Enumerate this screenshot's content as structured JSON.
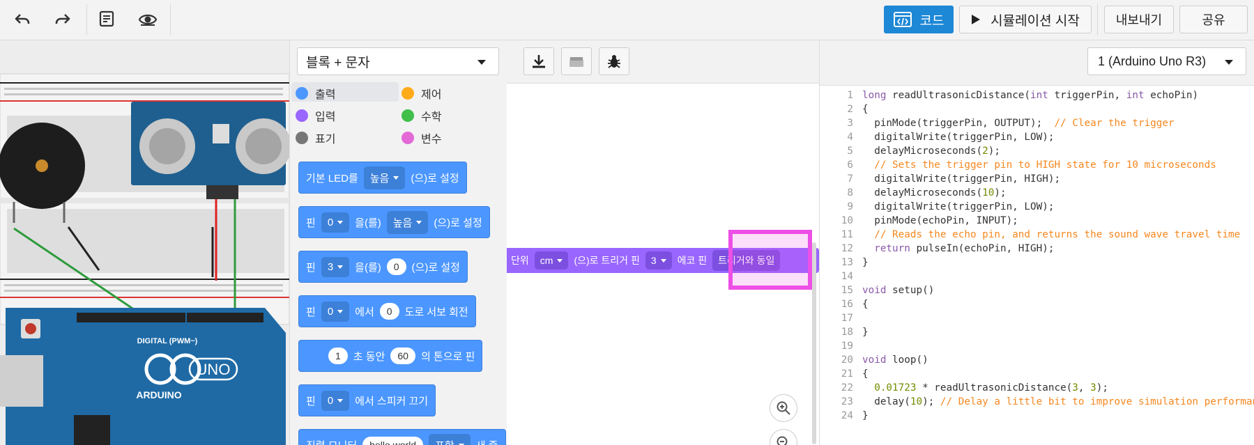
{
  "toolbar": {
    "undo_icon": "undo-icon",
    "redo_icon": "redo-icon",
    "notes_icon": "notes-icon",
    "eye_icon": "visibility-icon",
    "code_label": "코드",
    "simulate_label": "시뮬레이션 시작",
    "export_label": "내보내기",
    "share_label": "공유"
  },
  "palette": {
    "mode_select": "블록 + 문자",
    "categories": [
      {
        "label": "출력",
        "color": "#4c97ff"
      },
      {
        "label": "제어",
        "color": "#ffab19"
      },
      {
        "label": "입력",
        "color": "#9966ff"
      },
      {
        "label": "수학",
        "color": "#40bf4a"
      },
      {
        "label": "표기",
        "color": "#777777"
      },
      {
        "label": "변수",
        "color": "#e36ad6"
      }
    ],
    "blocks": {
      "b1": {
        "text1": "기본 LED를",
        "drop": "높음",
        "text2": "(으)로 설정"
      },
      "b2": {
        "text1": "핀",
        "drop1": "0",
        "text2": "을(를)",
        "drop2": "높음",
        "text3": "(으)로 설정"
      },
      "b3": {
        "text1": "핀",
        "drop1": "3",
        "text2": "을(를)",
        "val": "0",
        "text3": "(으)로 설정"
      },
      "b4": {
        "text1": "핀",
        "drop1": "0",
        "text2": "에서",
        "val": "0",
        "text3": "도로 서보 회전"
      },
      "b5": {
        "val1": "1",
        "text1": "초 동안",
        "val2": "60",
        "text2": "의 톤으로 핀"
      },
      "b6": {
        "text1": "핀",
        "drop1": "0",
        "text2": "에서 스피커 끄기"
      },
      "b7": {
        "text1": "직렬 모니터",
        "val": "hello world",
        "drop": "포함",
        "text2": "새 줄"
      }
    }
  },
  "canvas": {
    "download_icon": "download-icon",
    "library_icon": "library-icon",
    "debug_icon": "bug-icon",
    "purple_block": {
      "text1": "단위",
      "drop1": "cm",
      "text2": "(으)로 트리거 핀",
      "drop2": "3",
      "text3": "에코 핀",
      "drop3": "트리거와 동일"
    },
    "zoom_in_icon": "zoom-in-icon",
    "zoom_out_icon": "zoom-out-icon"
  },
  "code_panel": {
    "device": "1 (Arduino Uno R3)",
    "line_numbers": [
      "1",
      "2",
      "3",
      "4",
      "5",
      "6",
      "7",
      "8",
      "9",
      "10",
      "11",
      "12",
      "13",
      "14",
      "15",
      "16",
      "17",
      "18",
      "19",
      "20",
      "21",
      "22",
      "23",
      "24"
    ]
  }
}
